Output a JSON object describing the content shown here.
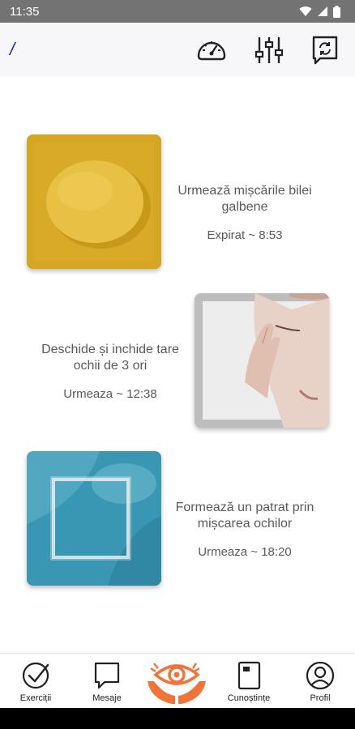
{
  "status_bar": {
    "time": "11:35",
    "icons": [
      "wifi-icon",
      "signal-icon",
      "battery-icon"
    ]
  },
  "top_bar": {
    "back_label": "/",
    "icons": [
      "speedometer-icon",
      "sliders-icon",
      "refresh-message-icon"
    ],
    "accent_color": "#1f2a9a"
  },
  "exercises": [
    {
      "title": "Urmează mișcările bilei galbene",
      "status": "Expirat ~ 8:53",
      "image": "yellow-ball-image",
      "color": "#d4a623"
    },
    {
      "title": "Deschide și inchide tare ochii de 3 ori",
      "status": "Urmeaza ~ 12:38",
      "image": "closing-eyes-photo",
      "color": "#bdbdbd"
    },
    {
      "title": "Formează un patrat prin mișcarea ochilor",
      "status": "Urmeaza ~ 18:20",
      "image": "square-motion-image",
      "color": "#3a97b4"
    }
  ],
  "bottom_nav": {
    "items": [
      {
        "label": "Exerciții",
        "icon": "checkmark-circle-icon"
      },
      {
        "label": "Mesaje",
        "icon": "chat-bubble-icon"
      },
      {
        "label": "",
        "icon": "eye-hands-logo"
      },
      {
        "label": "Cunoștințe",
        "icon": "book-icon"
      },
      {
        "label": "Profil",
        "icon": "user-profile-icon"
      }
    ],
    "logo_color": "#f0743a"
  }
}
